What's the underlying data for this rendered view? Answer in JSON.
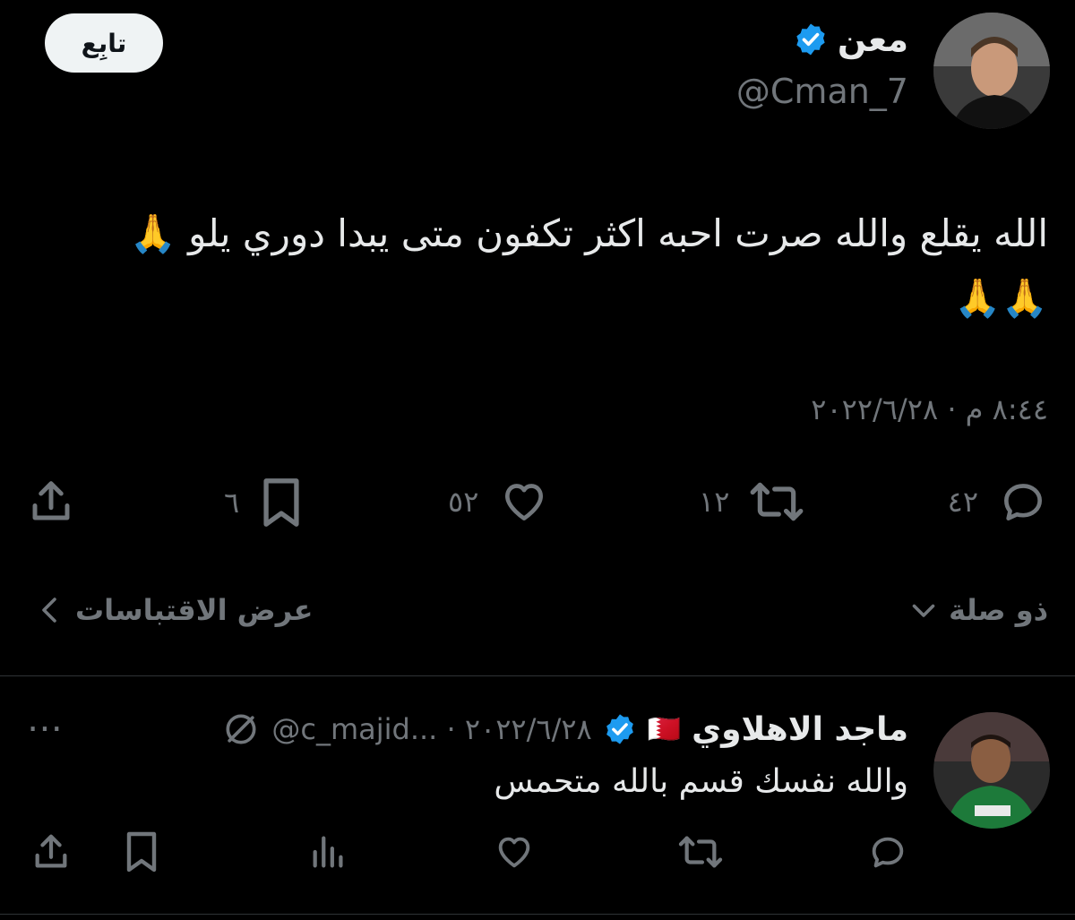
{
  "tweet": {
    "author_name": "معن",
    "author_handle": "@Cman_7",
    "follow_label": "تابِع",
    "text_line1": "الله يقلع والله صرت احبه اكثر تكفون متى يبدا دوري يلو 🙏",
    "text_line2": "🙏🙏",
    "timestamp": "٨:٤٤ م · ٢٠٢٢/٦/٢٨",
    "counts": {
      "replies": "٤٢",
      "retweets": "١٢",
      "likes": "٥٢",
      "bookmarks": "٦"
    },
    "related_label": "ذو صلة",
    "view_quotes_label": "عرض الاقتباسات"
  },
  "reply": {
    "author_name": "ماجد الاهلاوي",
    "flag": "🇧🇭",
    "meta": "@c_majid... · ٢٠٢٢/٦/٢٨",
    "more_label": "⋯",
    "text": "والله نفسك قسم بالله متحمس"
  },
  "colors": {
    "background": "#000000",
    "text": "#e7e9ea",
    "muted": "#71767b",
    "verified": "#1d9bf0",
    "follow_bg": "#eff3f4"
  }
}
